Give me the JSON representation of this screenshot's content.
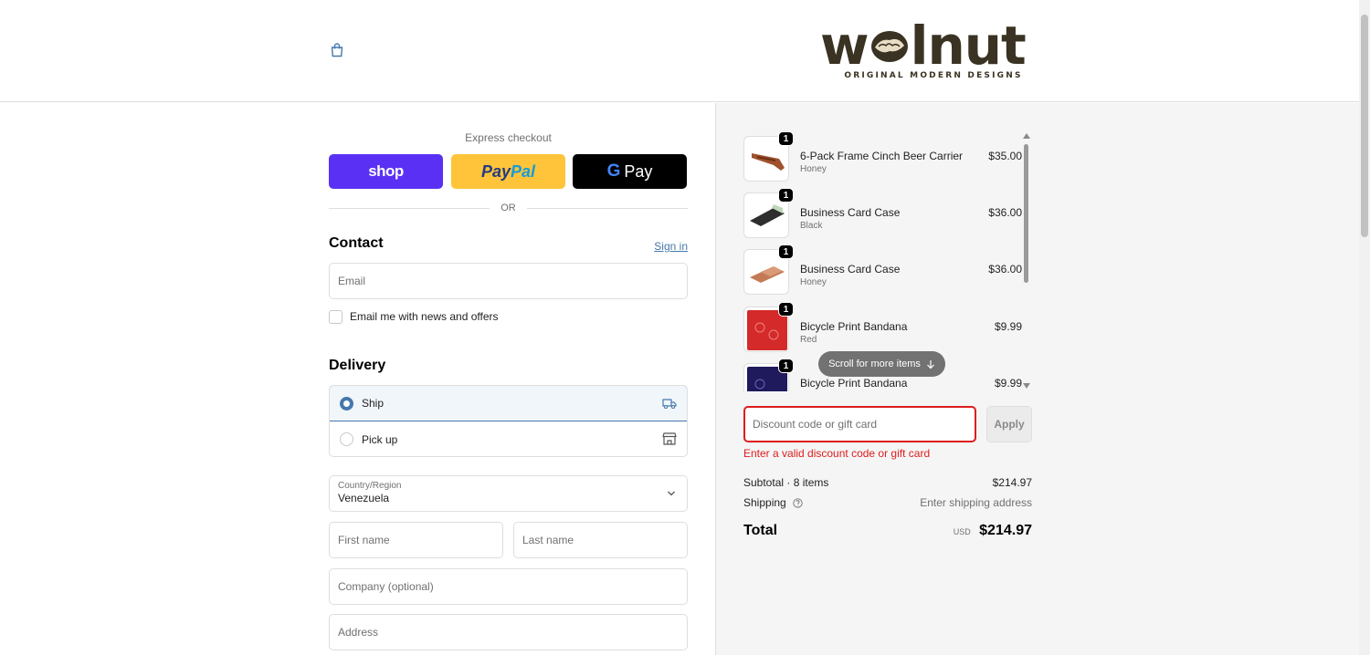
{
  "header": {
    "logo_word": "walnut",
    "logo_tagline": "ORIGINAL MODERN DESIGNS",
    "cart_icon": "shopping-bag-icon"
  },
  "express": {
    "title": "Express checkout",
    "shop_label": "shop",
    "paypal_pay": "Pay",
    "paypal_pal": "Pal",
    "gpay_g": "G",
    "gpay_label": "Pay",
    "or_label": "OR"
  },
  "contact": {
    "title": "Contact",
    "sign_in": "Sign in",
    "email_placeholder": "Email",
    "newsletter_label": "Email me with news and offers"
  },
  "delivery": {
    "title": "Delivery",
    "options": [
      {
        "label": "Ship",
        "selected": true,
        "icon": "truck-icon"
      },
      {
        "label": "Pick up",
        "selected": false,
        "icon": "store-icon"
      }
    ],
    "country_label": "Country/Region",
    "country_value": "Venezuela",
    "first_name": "First name",
    "last_name": "Last name",
    "company": "Company (optional)",
    "address": "Address"
  },
  "cart": {
    "items": [
      {
        "name": "6-Pack Frame Cinch Beer Carrier",
        "variant": "Honey",
        "price": "$35.00",
        "qty": "1",
        "color": "#a0522d"
      },
      {
        "name": "Business Card Case",
        "variant": "Black",
        "price": "$36.00",
        "qty": "1",
        "color": "#2e2e2e"
      },
      {
        "name": "Business Card Case",
        "variant": "Honey",
        "price": "$36.00",
        "qty": "1",
        "color": "#c47a55"
      },
      {
        "name": "Bicycle Print Bandana",
        "variant": "Red",
        "price": "$9.99",
        "qty": "1",
        "color": "#d42a2a"
      },
      {
        "name": "Bicycle Print Bandana",
        "variant": "Navy",
        "price": "$9.99",
        "qty": "1",
        "color": "#1f1a5c"
      }
    ],
    "scroll_hint": "Scroll for more items",
    "discount_placeholder": "Discount code or gift card",
    "apply_label": "Apply",
    "error": "Enter a valid discount code or gift card",
    "subtotal_label": "Subtotal · 8 items",
    "subtotal_value": "$214.97",
    "shipping_label": "Shipping",
    "shipping_value": "Enter shipping address",
    "total_label": "Total",
    "currency": "USD",
    "total_value": "$214.97"
  },
  "colors": {
    "shop_purple": "#5a31f4",
    "paypal_yellow": "#ffc439",
    "accent_blue": "#4578ab",
    "error_red": "#dd1d1d"
  }
}
